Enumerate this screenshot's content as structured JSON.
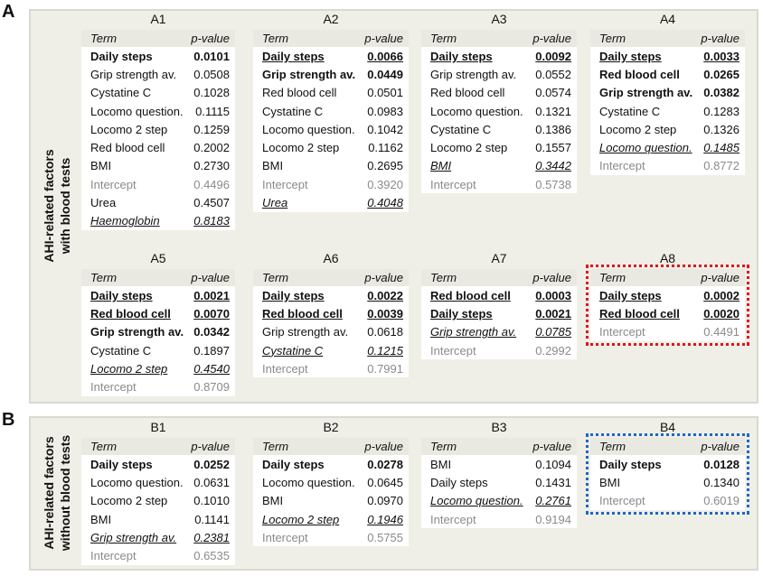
{
  "panels": [
    {
      "letter": "A",
      "side_label_line1": "AHI-related factors",
      "side_label_line2": "with blood tests",
      "models": [
        {
          "title": "A1",
          "header": {
            "term": "Term",
            "pvalue": "p-value"
          },
          "rows": [
            {
              "term": "Daily steps",
              "p": "0.0101",
              "style": "sig"
            },
            {
              "term": "Grip strength av.",
              "p": "0.0508",
              "style": "normal"
            },
            {
              "term": "Cystatine C",
              "p": "0.1028",
              "style": "normal"
            },
            {
              "term": "Locomo question.",
              "p": "0.1115",
              "style": "normal"
            },
            {
              "term": "Locomo 2 step",
              "p": "0.1259",
              "style": "normal"
            },
            {
              "term": "Red blood cell",
              "p": "0.2002",
              "style": "normal"
            },
            {
              "term": "BMI",
              "p": "0.2730",
              "style": "normal"
            },
            {
              "term": "Intercept",
              "p": "0.4496",
              "style": "intercept"
            },
            {
              "term": "Urea",
              "p": "0.4507",
              "style": "normal"
            },
            {
              "term": "Haemoglobin",
              "p": "0.8183",
              "style": "nonsig-u"
            }
          ]
        },
        {
          "title": "A2",
          "header": {
            "term": "Term",
            "pvalue": "p-value"
          },
          "rows": [
            {
              "term": "Daily steps",
              "p": "0.0066",
              "style": "sig-u"
            },
            {
              "term": "Grip strength av.",
              "p": "0.0449",
              "style": "sig"
            },
            {
              "term": "Red blood cell",
              "p": "0.0501",
              "style": "normal"
            },
            {
              "term": "Cystatine C",
              "p": "0.0983",
              "style": "normal"
            },
            {
              "term": "Locomo question.",
              "p": "0.1042",
              "style": "normal"
            },
            {
              "term": "Locomo 2 step",
              "p": "0.1162",
              "style": "normal"
            },
            {
              "term": "BMI",
              "p": "0.2695",
              "style": "normal"
            },
            {
              "term": "Intercept",
              "p": "0.3920",
              "style": "intercept"
            },
            {
              "term": "Urea",
              "p": "0.4048",
              "style": "nonsig-u"
            }
          ]
        },
        {
          "title": "A3",
          "header": {
            "term": "Term",
            "pvalue": "p-value"
          },
          "rows": [
            {
              "term": "Daily steps",
              "p": "0.0092",
              "style": "sig-u"
            },
            {
              "term": "Grip strength av.",
              "p": "0.0552",
              "style": "normal"
            },
            {
              "term": "Red blood cell",
              "p": "0.0574",
              "style": "normal"
            },
            {
              "term": "Locomo question.",
              "p": "0.1321",
              "style": "normal"
            },
            {
              "term": "Cystatine C",
              "p": "0.1386",
              "style": "normal"
            },
            {
              "term": "Locomo 2 step",
              "p": "0.1557",
              "style": "normal"
            },
            {
              "term": "BMI",
              "p": "0.3442",
              "style": "nonsig-u"
            },
            {
              "term": "Intercept",
              "p": "0.5738",
              "style": "intercept"
            }
          ]
        },
        {
          "title": "A4",
          "header": {
            "term": "Term",
            "pvalue": "p-value"
          },
          "rows": [
            {
              "term": "Daily steps",
              "p": "0.0033",
              "style": "sig-u"
            },
            {
              "term": "Red blood cell",
              "p": "0.0265",
              "style": "sig"
            },
            {
              "term": "Grip strength av.",
              "p": "0.0382",
              "style": "sig"
            },
            {
              "term": "Cystatine C",
              "p": "0.1283",
              "style": "normal"
            },
            {
              "term": "Locomo 2 step",
              "p": "0.1326",
              "style": "normal"
            },
            {
              "term": "Locomo question.",
              "p": "0.1485",
              "style": "nonsig-u"
            },
            {
              "term": "Intercept",
              "p": "0.8772",
              "style": "intercept"
            }
          ]
        },
        {
          "title": "A5",
          "header": {
            "term": "Term",
            "pvalue": "p-value"
          },
          "rows": [
            {
              "term": "Daily steps",
              "p": "0.0021",
              "style": "sig-u"
            },
            {
              "term": "Red blood cell",
              "p": "0.0070",
              "style": "sig-u"
            },
            {
              "term": "Grip strength av.",
              "p": "0.0342",
              "style": "sig"
            },
            {
              "term": "Cystatine C",
              "p": "0.1897",
              "style": "normal"
            },
            {
              "term": "Locomo 2 step",
              "p": "0.4540",
              "style": "nonsig-u"
            },
            {
              "term": "Intercept",
              "p": "0.8709",
              "style": "intercept"
            }
          ]
        },
        {
          "title": "A6",
          "header": {
            "term": "Term",
            "pvalue": "p-value"
          },
          "rows": [
            {
              "term": "Daily steps",
              "p": "0.0022",
              "style": "sig-u"
            },
            {
              "term": "Red blood cell",
              "p": "0.0039",
              "style": "sig-u"
            },
            {
              "term": "Grip strength av.",
              "p": "0.0618",
              "style": "normal"
            },
            {
              "term": "Cystatine C",
              "p": "0.1215",
              "style": "nonsig-u"
            },
            {
              "term": "Intercept",
              "p": "0.7991",
              "style": "intercept"
            }
          ]
        },
        {
          "title": "A7",
          "header": {
            "term": "Term",
            "pvalue": "p-value"
          },
          "rows": [
            {
              "term": "Red blood cell",
              "p": "0.0003",
              "style": "sig-u"
            },
            {
              "term": "Daily steps",
              "p": "0.0021",
              "style": "sig-u"
            },
            {
              "term": "Grip strength av.",
              "p": "0.0785",
              "style": "nonsig-u"
            },
            {
              "term": "Intercept",
              "p": "0.2992",
              "style": "intercept"
            }
          ]
        },
        {
          "title": "A8",
          "highlight": "#e0121f",
          "header": {
            "term": "Term",
            "pvalue": "p-value"
          },
          "rows": [
            {
              "term": "Daily steps",
              "p": "0.0002",
              "style": "sig-u"
            },
            {
              "term": "Red blood cell",
              "p": "0.0020",
              "style": "sig-u"
            },
            {
              "term": "Intercept",
              "p": "0.4491",
              "style": "intercept"
            }
          ]
        }
      ]
    },
    {
      "letter": "B",
      "side_label_line1": "AHI-related factors",
      "side_label_line2": "without blood tests",
      "models": [
        {
          "title": "B1",
          "header": {
            "term": "Term",
            "pvalue": "p-value"
          },
          "rows": [
            {
              "term": "Daily steps",
              "p": "0.0252",
              "style": "sig"
            },
            {
              "term": "Locomo question.",
              "p": "0.0631",
              "style": "normal"
            },
            {
              "term": "Locomo 2 step",
              "p": "0.1010",
              "style": "normal"
            },
            {
              "term": "BMI",
              "p": "0.1141",
              "style": "normal"
            },
            {
              "term": "Grip strength av.",
              "p": "0.2381",
              "style": "nonsig-u"
            },
            {
              "term": "Intercept",
              "p": "0.6535",
              "style": "intercept"
            }
          ]
        },
        {
          "title": "B2",
          "header": {
            "term": "Term",
            "pvalue": "p-value"
          },
          "rows": [
            {
              "term": "Daily steps",
              "p": "0.0278",
              "style": "sig"
            },
            {
              "term": "Locomo question.",
              "p": "0.0645",
              "style": "normal"
            },
            {
              "term": "BMI",
              "p": "0.0970",
              "style": "normal"
            },
            {
              "term": "Locomo 2 step",
              "p": "0.1946",
              "style": "nonsig-u"
            },
            {
              "term": "Intercept",
              "p": "0.5755",
              "style": "intercept"
            }
          ]
        },
        {
          "title": "B3",
          "header": {
            "term": "Term",
            "pvalue": "p-value"
          },
          "rows": [
            {
              "term": "BMI",
              "p": "0.1094",
              "style": "normal"
            },
            {
              "term": "Daily steps",
              "p": "0.1431",
              "style": "normal"
            },
            {
              "term": "Locomo question.",
              "p": "0.2761",
              "style": "nonsig-u"
            },
            {
              "term": "Intercept",
              "p": "0.9194",
              "style": "intercept"
            }
          ]
        },
        {
          "title": "B4",
          "highlight": "#1f66c7",
          "header": {
            "term": "Term",
            "pvalue": "p-value"
          },
          "rows": [
            {
              "term": "Daily steps",
              "p": "0.0128",
              "style": "sig"
            },
            {
              "term": "BMI",
              "p": "0.1340",
              "style": "normal"
            },
            {
              "term": "Intercept",
              "p": "0.6019",
              "style": "intercept"
            }
          ]
        }
      ]
    }
  ]
}
